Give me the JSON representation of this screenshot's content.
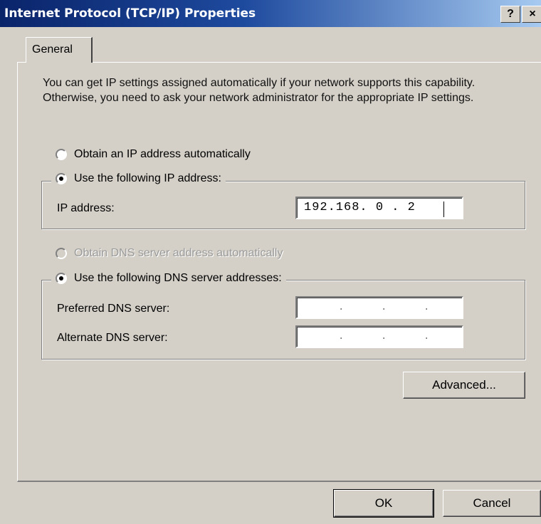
{
  "window": {
    "title": "Internet Protocol (TCP/IP) Properties",
    "help_button": "?",
    "close_button": "×"
  },
  "tabs": [
    {
      "label": "General"
    }
  ],
  "description": "You can get IP settings assigned automatically if your network supports this capability. Otherwise, you need to ask your network administrator for the appropriate IP settings.",
  "ip_section": {
    "auto_option": {
      "label": "Obtain an IP address automatically",
      "selected": false
    },
    "manual_option": {
      "label": "Use the following IP address:",
      "selected": true
    },
    "ip_address": {
      "label": "IP address:",
      "value": "192.168. 0 . 2"
    }
  },
  "dns_section": {
    "auto_option": {
      "label": "Obtain DNS server address automatically",
      "selected": false,
      "disabled": true
    },
    "manual_option": {
      "label": "Use the following DNS server addresses:",
      "selected": true
    },
    "preferred": {
      "label": "Preferred DNS server:",
      "value": ""
    },
    "alternate": {
      "label": "Alternate DNS server:",
      "value": ""
    }
  },
  "buttons": {
    "advanced": "Advanced...",
    "ok": "OK",
    "cancel": "Cancel"
  }
}
